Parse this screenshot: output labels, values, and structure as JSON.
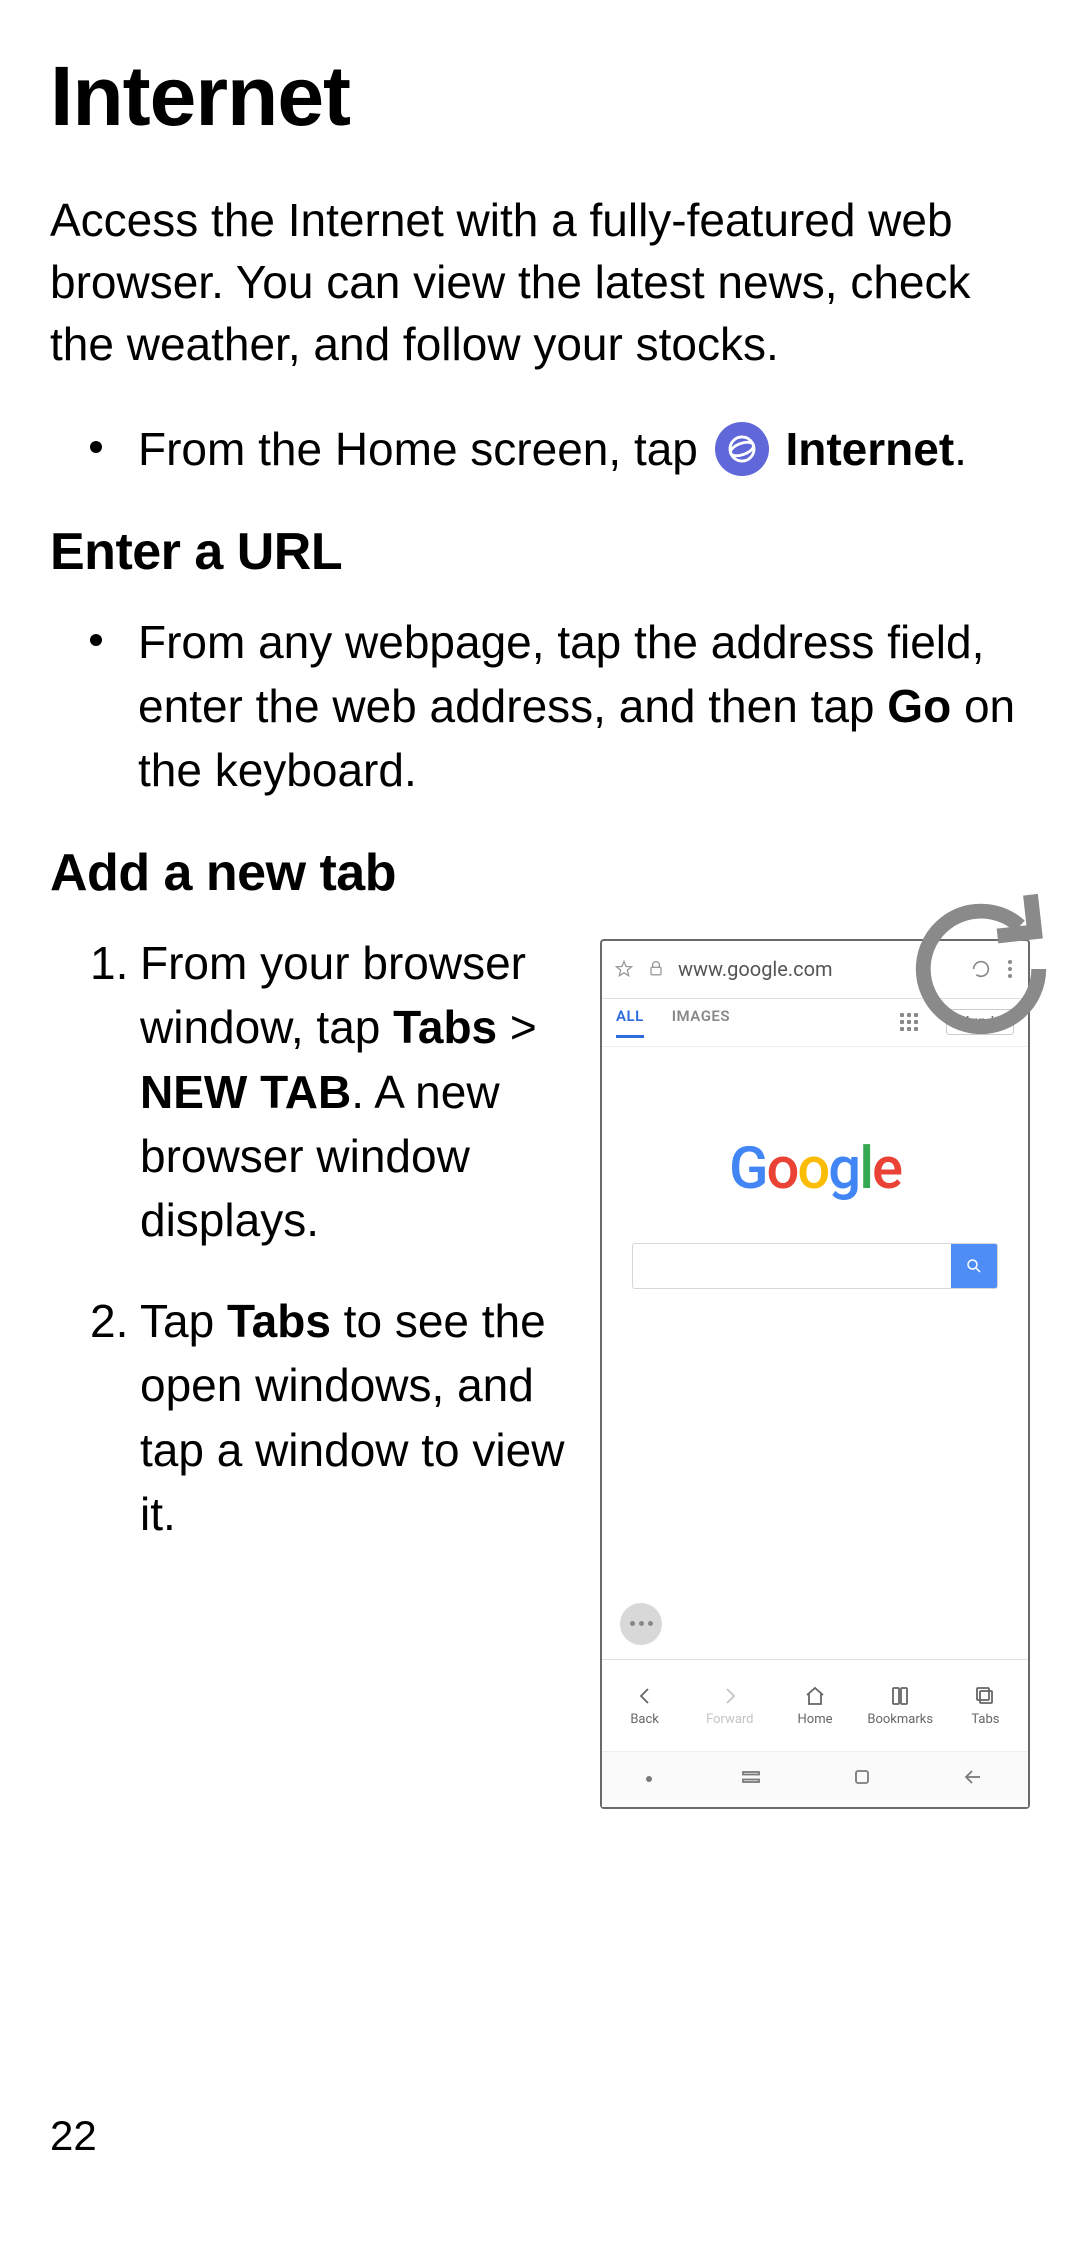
{
  "page": {
    "title": "Internet",
    "intro": "Access the Internet with a fully-featured web browser. You can view the latest news, check the weather, and follow your stocks.",
    "page_number": "22"
  },
  "home_bullet": {
    "prefix": "From the Home screen, tap ",
    "app_label": "Internet",
    "suffix": "."
  },
  "enter_url": {
    "heading": "Enter a URL",
    "bullet_pre": "From any webpage, tap the address field, enter the web address, and then tap ",
    "bullet_bold": "Go",
    "bullet_post": " on the keyboard."
  },
  "add_tab": {
    "heading": "Add a new tab",
    "step1_pre": "From your browser window, tap ",
    "step1_b1": "Tabs",
    "step1_mid": " > ",
    "step1_b2": "NEW TAB",
    "step1_post": ". A new browser window displays.",
    "step2_pre": "Tap ",
    "step2_b1": "Tabs",
    "step2_post": " to see the open windows, and tap a window to view it."
  },
  "screenshot": {
    "url": "www.google.com",
    "tabs": {
      "all": "ALL",
      "images": "IMAGES"
    },
    "signin": "Sign in",
    "logo_letters": [
      "G",
      "o",
      "o",
      "g",
      "l",
      "e"
    ],
    "bottombar": {
      "back": "Back",
      "forward": "Forward",
      "home": "Home",
      "bookmarks": "Bookmarks",
      "tabs": "Tabs"
    }
  }
}
